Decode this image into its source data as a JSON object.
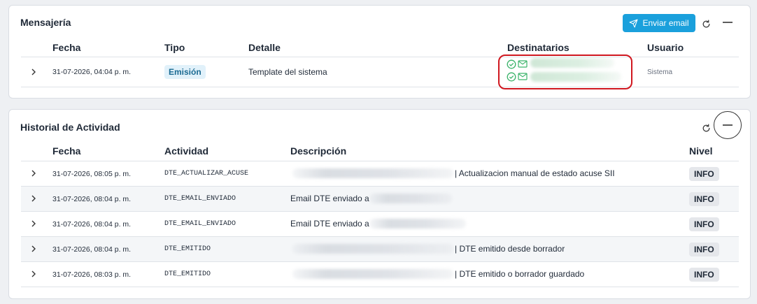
{
  "mensajeria": {
    "title": "Mensajería",
    "send_button": "Enviar email",
    "columns": {
      "fecha": "Fecha",
      "tipo": "Tipo",
      "detalle": "Detalle",
      "destinatarios": "Destinatarios",
      "usuario": "Usuario"
    },
    "rows": [
      {
        "fecha": "31-07-2026, 04:04 p. m.",
        "tipo": "Emisión",
        "detalle": "Template del sistema",
        "usuario": "Sistema"
      }
    ]
  },
  "historial": {
    "title": "Historial de Actividad",
    "columns": {
      "fecha": "Fecha",
      "actividad": "Actividad",
      "descripcion": "Descripción",
      "nivel": "Nivel"
    },
    "rows": [
      {
        "fecha": "31-07-2026, 08:05 p. m.",
        "actividad": "DTE_ACTUALIZAR_ACUSE",
        "descripcion": "| Actualizacion manual de estado acuse SII",
        "nivel": "INFO"
      },
      {
        "fecha": "31-07-2026, 08:04 p. m.",
        "actividad": "DTE_EMAIL_ENVIADO",
        "descripcion": "Email DTE enviado a",
        "nivel": "INFO"
      },
      {
        "fecha": "31-07-2026, 08:04 p. m.",
        "actividad": "DTE_EMAIL_ENVIADO",
        "descripcion": "Email DTE enviado a",
        "nivel": "INFO"
      },
      {
        "fecha": "31-07-2026, 08:04 p. m.",
        "actividad": "DTE_EMITIDO",
        "descripcion": "| DTE emitido desde borrador",
        "nivel": "INFO"
      },
      {
        "fecha": "31-07-2026, 08:03 p. m.",
        "actividad": "DTE_EMITIDO",
        "descripcion": "| DTE emitido o borrador guardado",
        "nivel": "INFO"
      }
    ]
  },
  "icons": {
    "send": "send-icon",
    "refresh": "refresh-icon",
    "collapse": "minus-icon",
    "expand": "chevron-right-icon",
    "check": "check-circle-icon",
    "mail": "mail-icon"
  },
  "colors": {
    "accent": "#1aa0dc",
    "highlight": "#d0171f",
    "success": "#3bb36a",
    "tipo_badge_bg": "#e1f1fa",
    "tipo_badge_fg": "#1a6a92"
  }
}
